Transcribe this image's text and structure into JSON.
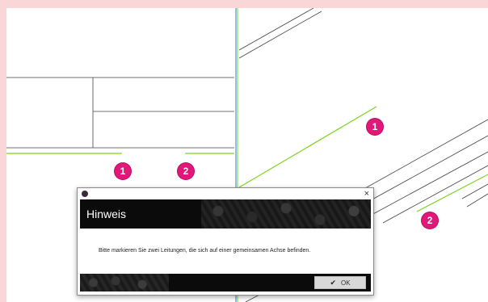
{
  "badges": {
    "left_1": "1",
    "left_2": "2",
    "right_1": "1",
    "right_2": "2"
  },
  "colors": {
    "badge": "#e2177a",
    "highlight_line": "#7ed321",
    "background": "#f9d6d7"
  },
  "dialog": {
    "title": "Hinweis",
    "message": "Bitte markieren Sie zwei Leitungen, die sich auf einer gemeinsamen Achse befinden.",
    "ok_label": "OK",
    "close_glyph": "×",
    "ok_icon": "check-icon"
  }
}
